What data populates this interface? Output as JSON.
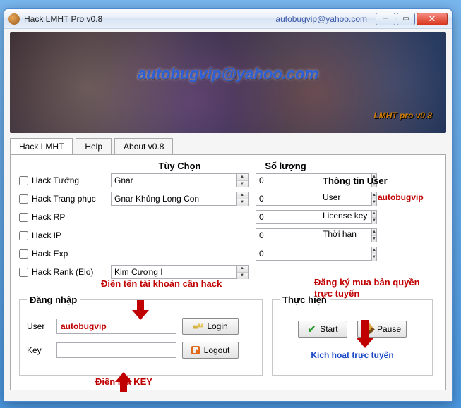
{
  "window": {
    "title": "Hack LMHT Pro v0.8",
    "contact_email": "autobugvip@yahoo.com"
  },
  "banner": {
    "overlay_email": "autobugvip@yahoo.com",
    "version_text": "LMHT pro v0.8"
  },
  "tabs": {
    "main": "Hack LMHT",
    "help": "Help",
    "about": "About v0.8"
  },
  "headers": {
    "option": "Tùy Chọn",
    "qty": "Số lượng"
  },
  "rows": {
    "champ": {
      "label": "Hack Tướng",
      "option": "Gnar",
      "qty": "0"
    },
    "skin": {
      "label": "Hack Trang phục",
      "option": "Gnar Khủng Long Con",
      "qty": "0"
    },
    "rp": {
      "label": "Hack RP",
      "qty": "0"
    },
    "ip": {
      "label": "Hack IP",
      "qty": "0"
    },
    "exp": {
      "label": "Hack Exp",
      "qty": "0"
    },
    "rank": {
      "label": "Hack Rank (Elo)",
      "option": "Kim Cương I"
    }
  },
  "userinfo": {
    "header": "Thông tin User",
    "user_label": "User",
    "user_value": "autobugvip",
    "license_label": "License key",
    "expiry_label": "Thời hạn"
  },
  "login": {
    "legend": "Đăng nhập",
    "user_label": "User",
    "user_value": "autobugvip",
    "key_label": "Key",
    "key_value": "",
    "login_btn": "Login",
    "logout_btn": "Logout"
  },
  "action": {
    "legend": "Thực hiện",
    "start": "Start",
    "pause": "Pause",
    "activate_link": "Kích hoạt trực tuyến"
  },
  "annotations": {
    "acct": "Điền tên tài khoản cần hack",
    "key": "Điền mã KEY",
    "buy": "Đăng ký mua bản quyền trực tuyến"
  }
}
